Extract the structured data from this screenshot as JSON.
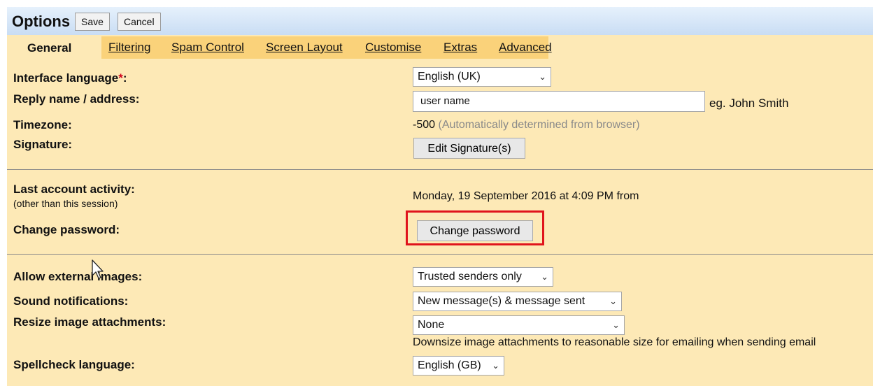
{
  "header": {
    "title": "Options",
    "save_label": "Save",
    "cancel_label": "Cancel"
  },
  "tabs": [
    {
      "label": "General",
      "active": true
    },
    {
      "label": "Filtering"
    },
    {
      "label": "Spam Control"
    },
    {
      "label": "Screen Layout"
    },
    {
      "label": "Customise"
    },
    {
      "label": "Extras"
    },
    {
      "label": "Advanced"
    }
  ],
  "general": {
    "interface_language": {
      "label": "Interface language",
      "required_mark": "*",
      "suffix": ":",
      "value": "English (UK)"
    },
    "reply_name": {
      "label": "Reply name / address:",
      "value": "user name",
      "hint": "eg. John Smith"
    },
    "timezone": {
      "label": "Timezone:",
      "value": "-500",
      "note": "(Automatically determined from browser)"
    },
    "signature": {
      "label": "Signature:",
      "button": "Edit Signature(s)"
    }
  },
  "account": {
    "last_activity": {
      "label": "Last account activity:",
      "sublabel": "(other than this session)",
      "value": "Monday, 19 September 2016 at 4:09 PM from"
    },
    "change_password": {
      "label": "Change password:",
      "button": "Change password"
    }
  },
  "media": {
    "external_images": {
      "label": "Allow external images:",
      "value": "Trusted senders only"
    },
    "sound": {
      "label": "Sound notifications:",
      "value": "New message(s) & message sent"
    },
    "resize": {
      "label": "Resize image attachments:",
      "value": "None",
      "note": "Downsize image attachments to reasonable size for emailing when sending email"
    },
    "spellcheck": {
      "label": "Spellcheck language:",
      "value": "English (GB)"
    }
  },
  "colors": {
    "background": "#fde9b6",
    "tab_bar": "#fad27a",
    "header": "#c9ddf4",
    "highlight": "#e0141c",
    "required": "#d0021b"
  }
}
